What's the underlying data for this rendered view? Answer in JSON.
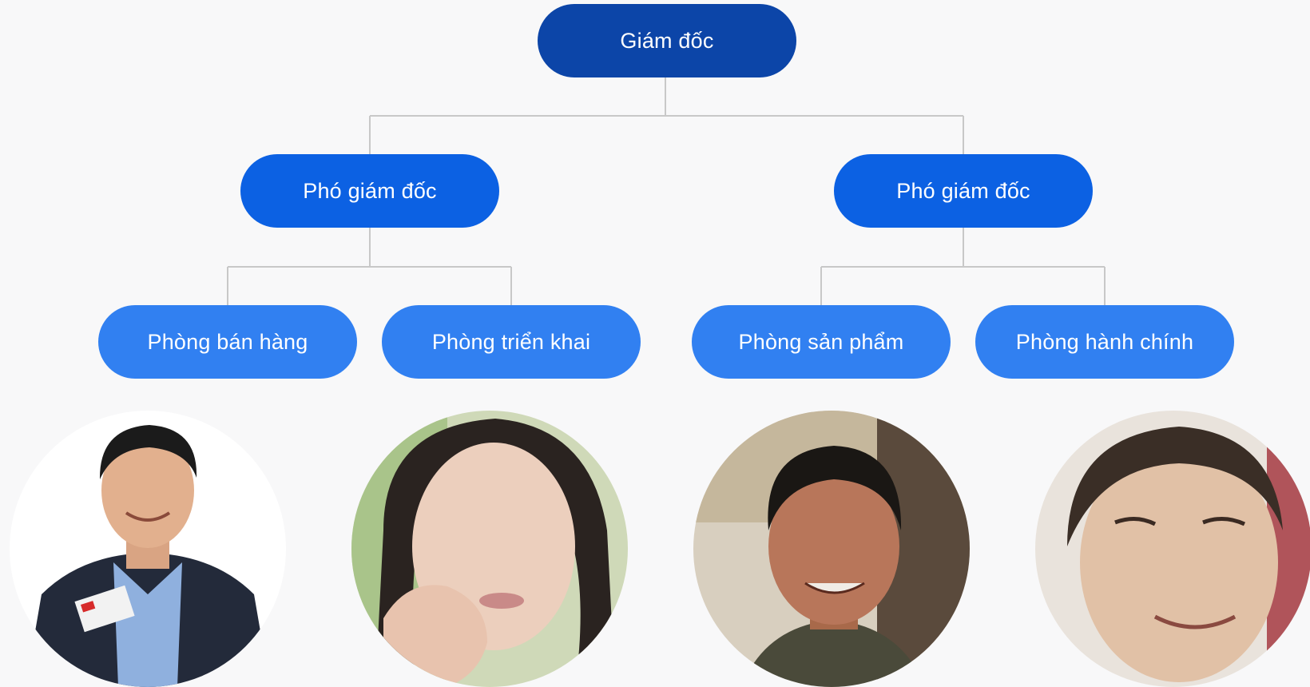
{
  "org_chart": {
    "root": {
      "label": "Giám đốc"
    },
    "deputies": [
      {
        "label": "Phó giám đốc"
      },
      {
        "label": "Phó giám đốc"
      }
    ],
    "departments": [
      {
        "label": "Phòng bán hàng"
      },
      {
        "label": "Phòng triển khai"
      },
      {
        "label": "Phòng sản phẩm"
      },
      {
        "label": "Phòng hành chính"
      }
    ]
  },
  "colors": {
    "level0": "#0c45a8",
    "level1": "#0c61e3",
    "level2": "#3180f1",
    "connector": "#c8c8c8",
    "background": "#f8f8f9"
  }
}
